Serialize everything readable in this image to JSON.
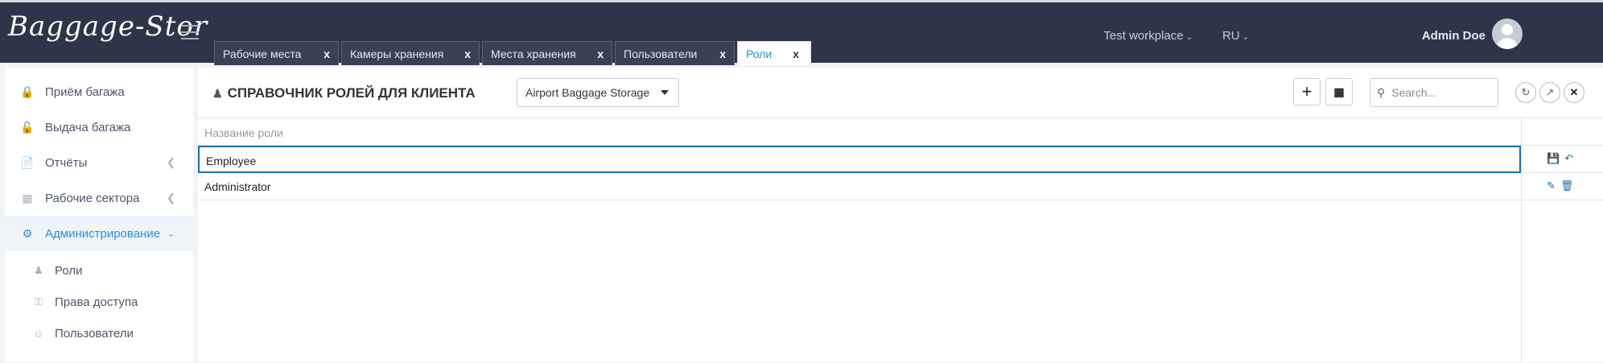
{
  "app": {
    "logo": "Baggage-Stor"
  },
  "tabs": [
    {
      "label": "Рабочие места",
      "close": "x"
    },
    {
      "label": "Камеры хранения",
      "close": "x"
    },
    {
      "label": "Места хранения",
      "close": "x"
    },
    {
      "label": "Пользователи",
      "close": "x"
    },
    {
      "label": "Роли",
      "close": "x"
    }
  ],
  "topbar": {
    "workplace": "Test workplace",
    "lang": "RU",
    "user": "Admin Doe"
  },
  "sidebar": {
    "items": [
      {
        "label": "Приём багажа"
      },
      {
        "label": "Выдача багажа"
      },
      {
        "label": "Отчёты"
      },
      {
        "label": "Рабочие сектора"
      },
      {
        "label": "Администрирование"
      }
    ],
    "sub": [
      {
        "label": "Роли"
      },
      {
        "label": "Права доступа"
      },
      {
        "label": "Пользователи"
      }
    ]
  },
  "main": {
    "title": "СПРАВОЧНИК РОЛЕЙ ДЛЯ КЛИЕНТА",
    "client_select": "Airport Baggage Storage",
    "search_placeholder": "Search...",
    "column_header": "Название роли",
    "rows": [
      {
        "name": "Employee",
        "state": "editing"
      },
      {
        "name": "Administrator",
        "state": "view"
      }
    ]
  }
}
